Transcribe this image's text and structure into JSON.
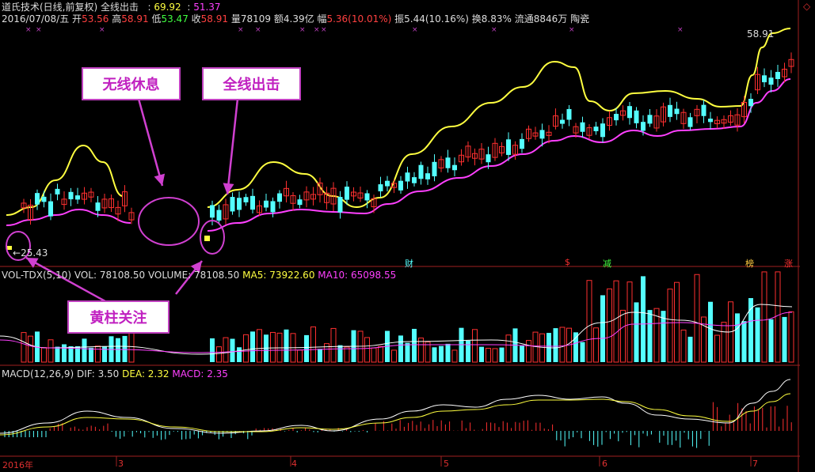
{
  "header": {
    "date": "2016/07/08/五",
    "title": "道氏技术(日线,前复权) 全线出击",
    "line1_value": "69.92",
    "line2_value": "51.37",
    "open_label": "开",
    "open": "53.56",
    "high_label": "高",
    "high": "58.91",
    "low_label": "低",
    "low": "53.47",
    "close_label": "收",
    "close": "58.91",
    "volume": "量78109",
    "amount": "额4.39亿",
    "change_label": "幅",
    "change": "5.36(10.01%)",
    "amplitude": "振5.44(10.16%)",
    "turnover": "换8.83%",
    "float": "流通8846万",
    "tag": "陶瓷"
  },
  "price_marks": {
    "high_mark": "58.91",
    "low_mark": "25.43",
    "low_arrow": "←"
  },
  "volume_header": {
    "name": "VOL-TDX(5,10)",
    "vol": "VOL: 78108.50",
    "volume": "VOLUME: 78108.50",
    "ma5": "MA5: 73922.60",
    "ma10": "MA10: 65098.55"
  },
  "macd_header": {
    "name": "MACD(12,26,9)",
    "dif": "DIF: 3.50",
    "dea": "DEA: 2.32",
    "macd": "MACD: 2.35"
  },
  "annotations": {
    "rest": "无线休息",
    "attack": "全线出击",
    "yellow_bar": "黄柱关注"
  },
  "signals": [
    "财",
    "$",
    "减",
    "榜",
    "涨"
  ],
  "x_axis": [
    "2016年",
    "3",
    "4",
    "5",
    "6",
    "7"
  ],
  "colors": {
    "up": "#ff3030",
    "down": "#54ffff",
    "yellow_line": "#ffff40",
    "magenta_line": "#ff40ff",
    "white_line": "#ffffff"
  }
}
